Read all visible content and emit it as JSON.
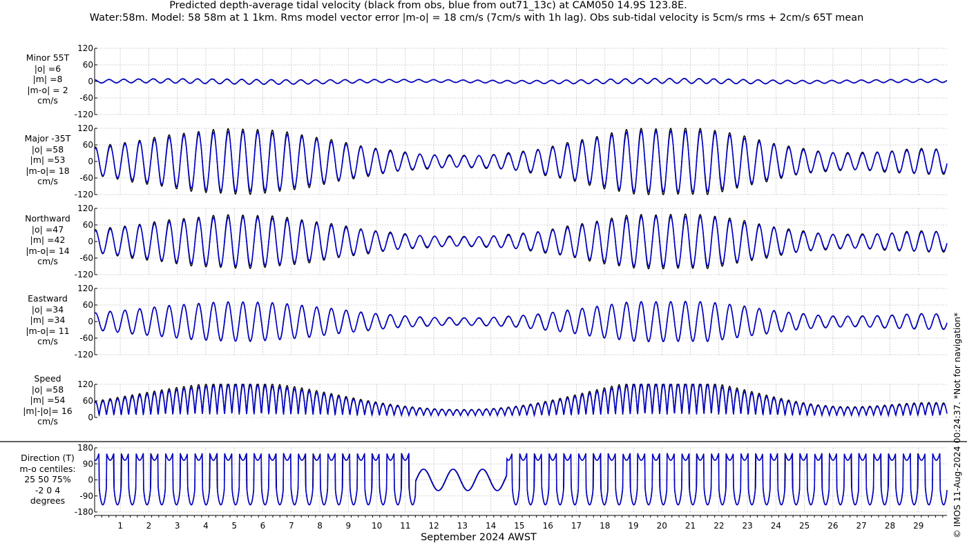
{
  "header": {
    "title_line1": "Predicted depth-average tidal velocity (black from obs, blue from out71_13c) at CAM050 14.9S 123.8E.",
    "title_line2": "Water:58m. Model: 58 58m at 1 1km. Rms model vector error |m-o| = 18 cm/s (7cm/s with 1h lag). Obs sub-tidal velocity is 5cm/s rms + 2cm/s 65T mean"
  },
  "copyright": "© IMOS 11-Aug-2024 00:24:37. *Not for navigation*",
  "colors": {
    "obs": "#000000",
    "model": "#0000cc",
    "grid": "#b4b4b4"
  },
  "chart_data": {
    "type": "line",
    "xlabel": "September 2024 AWST",
    "x_tick_labels": [
      "1",
      "2",
      "3",
      "4",
      "5",
      "6",
      "7",
      "8",
      "9",
      "10",
      "11",
      "12",
      "13",
      "14",
      "15",
      "16",
      "17",
      "18",
      "19",
      "20",
      "21",
      "22",
      "23",
      "24",
      "25",
      "26",
      "27",
      "28",
      "29"
    ],
    "xlim": [
      0.1,
      30.0
    ],
    "series_legend": {
      "obs": "black from obs",
      "model": "blue from out71_13c"
    },
    "panels": [
      {
        "id": "minor",
        "label_lines": [
          "Minor 55T",
          "|o| =6",
          "|m| =8",
          "|m-o| = 2",
          "cm/s"
        ],
        "ylim": [
          -120,
          120
        ],
        "yticks": [
          "120",
          "60",
          "0",
          "-60",
          "-120"
        ],
        "tick_values": [
          120,
          60,
          0,
          -60,
          -120
        ],
        "kind": "component",
        "obs_amp": 8,
        "model_amp": 9,
        "phase": 0.5
      },
      {
        "id": "major",
        "label_lines": [
          "Major -35T",
          "|o| =58",
          "|m| =53",
          "|m-o|= 18",
          "cm/s"
        ],
        "ylim": [
          -120,
          120
        ],
        "yticks": [
          "120",
          "60",
          "0",
          "-60",
          "-120"
        ],
        "tick_values": [
          120,
          60,
          0,
          -60,
          -120
        ],
        "kind": "component",
        "obs_amp": 120,
        "model_amp": 110,
        "phase": 0.0
      },
      {
        "id": "north",
        "label_lines": [
          "Northward",
          "|o| =47",
          "|m| =42",
          "|m-o|= 14",
          "cm/s"
        ],
        "ylim": [
          -120,
          120
        ],
        "yticks": [
          "120",
          "60",
          "0",
          "-60",
          "-120"
        ],
        "tick_values": [
          120,
          60,
          0,
          -60,
          -120
        ],
        "kind": "component",
        "obs_amp": 98,
        "model_amp": 90,
        "phase": 0.0
      },
      {
        "id": "east",
        "label_lines": [
          "Eastward",
          "|o| =34",
          "|m| =34",
          "|m-o|= 11",
          "cm/s"
        ],
        "ylim": [
          -120,
          120
        ],
        "yticks": [
          "120",
          "60",
          "0",
          "-60",
          "-120"
        ],
        "tick_values": [
          120,
          60,
          0,
          -60,
          -120
        ],
        "kind": "component",
        "obs_amp": 72,
        "model_amp": 72,
        "phase": 0.0
      },
      {
        "id": "speed",
        "label_lines": [
          "Speed",
          "|o| =58",
          "|m| =54",
          "|m|-|o|= 16",
          "cm/s"
        ],
        "ylim": [
          0,
          120
        ],
        "yticks": [
          "120",
          "60",
          "0"
        ],
        "tick_values": [
          120,
          60,
          0
        ],
        "kind": "speed",
        "obs_amp": 120,
        "model_amp": 110,
        "phase": 0.0
      },
      {
        "id": "direction",
        "label_lines": [
          "Direction (T)",
          "m-o centiles:",
          "25  50  75%",
          "-2  0  4",
          "degrees"
        ],
        "ylim": [
          -180,
          180
        ],
        "yticks": [
          "180",
          "90",
          "0",
          "-90",
          "-180"
        ],
        "tick_values": [
          180,
          90,
          0,
          -90,
          -180
        ],
        "kind": "direction",
        "obs_amp": 180,
        "model_amp": 180,
        "phase": 0.0
      }
    ],
    "envelope": {
      "peak1_day": 5.3,
      "peak2_day": 20.3,
      "neap_days": [
        13.2,
        27.5
      ],
      "period_days": 0.5175
    },
    "grid": true
  }
}
